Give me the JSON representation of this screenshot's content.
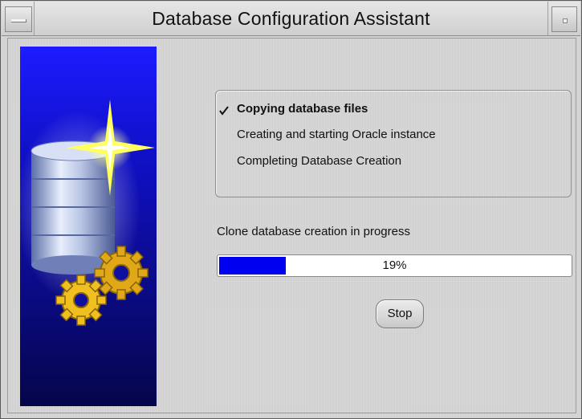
{
  "window": {
    "title": "Database Configuration Assistant"
  },
  "steps": [
    {
      "label": "Copying database files",
      "state": "current"
    },
    {
      "label": "Creating and starting Oracle instance",
      "state": "pending"
    },
    {
      "label": "Completing Database Creation",
      "state": "pending"
    }
  ],
  "status": {
    "label": "Clone database creation in progress"
  },
  "progress": {
    "percent": 19,
    "text": "19%"
  },
  "buttons": {
    "stop_label": "Stop"
  },
  "icons": {
    "step_marker": "checkmark-icon",
    "artwork": [
      "database-cylinder-icon",
      "sparkle-star-icon",
      "gear-icon",
      "gear-icon"
    ]
  },
  "colors": {
    "progress_fill": "#0000f0",
    "artwork_blue": "#1c1cff",
    "gear_gold": "#f0c020"
  }
}
